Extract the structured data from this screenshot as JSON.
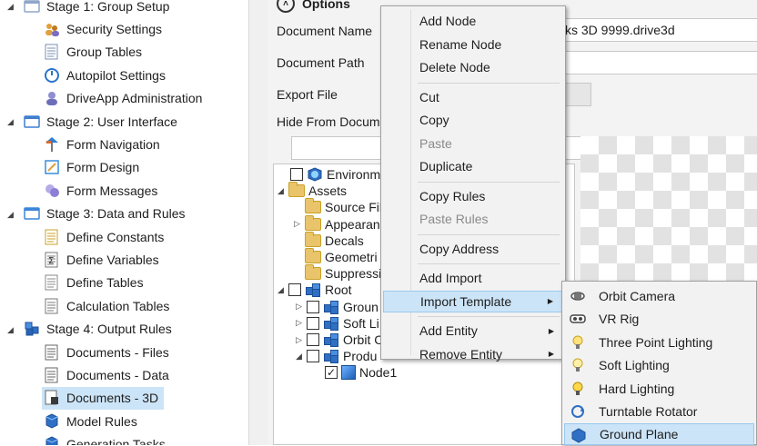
{
  "nav": {
    "items": [
      {
        "label": "Stage 1: Group Setup",
        "level": 0,
        "icon": "stage-setup-icon"
      },
      {
        "label": "Security Settings",
        "level": 1,
        "icon": "security-icon"
      },
      {
        "label": "Group Tables",
        "level": 1,
        "icon": "group-tables-icon"
      },
      {
        "label": "Autopilot Settings",
        "level": 1,
        "icon": "autopilot-icon"
      },
      {
        "label": "DriveApp Administration",
        "level": 1,
        "icon": "admin-icon"
      },
      {
        "label": "Stage 2: User Interface",
        "level": 0,
        "icon": "stage-ui-icon"
      },
      {
        "label": "Form Navigation",
        "level": 1,
        "icon": "form-navigation-icon"
      },
      {
        "label": "Form Design",
        "level": 1,
        "icon": "form-design-icon"
      },
      {
        "label": "Form Messages",
        "level": 1,
        "icon": "form-messages-icon"
      },
      {
        "label": "Stage 3: Data and Rules",
        "level": 0,
        "icon": "stage-data-icon"
      },
      {
        "label": "Define Constants",
        "level": 1,
        "icon": "constants-icon"
      },
      {
        "label": "Define Variables",
        "level": 1,
        "icon": "variables-icon"
      },
      {
        "label": "Define Tables",
        "level": 1,
        "icon": "tables-icon"
      },
      {
        "label": "Calculation Tables",
        "level": 1,
        "icon": "calc-tables-icon"
      },
      {
        "label": "Stage 4: Output Rules",
        "level": 0,
        "icon": "stage-output-icon"
      },
      {
        "label": "Documents - Files",
        "level": 1,
        "icon": "documents-files-icon"
      },
      {
        "label": "Documents - Data",
        "level": 1,
        "icon": "documents-data-icon"
      },
      {
        "label": "Documents - 3D",
        "level": 1,
        "icon": "documents-3d-icon",
        "selected": true
      },
      {
        "label": "Model Rules",
        "level": 1,
        "icon": "model-rules-icon"
      },
      {
        "label": "Generation Tasks",
        "level": 1,
        "icon": "generation-tasks-icon"
      }
    ]
  },
  "options": {
    "title": "Options",
    "document_name_label": "Document Name",
    "document_name_value": "ks 3D 9999.drive3d",
    "document_path_label": "Document Path",
    "export_file_label": "Export File",
    "hide_from_label": "Hide From Docum"
  },
  "tree": {
    "nodes": [
      {
        "label": "Environm",
        "depth": 1,
        "checkbox": true,
        "icon": "environment-icon"
      },
      {
        "label": "Assets",
        "depth": 0,
        "expander": "open",
        "icon": "folder-icon"
      },
      {
        "label": "Source Fil",
        "depth": 1,
        "icon": "folder-icon"
      },
      {
        "label": "Appearan",
        "depth": 1,
        "expander": "closed",
        "icon": "folder-icon"
      },
      {
        "label": "Decals",
        "depth": 1,
        "icon": "folder-icon"
      },
      {
        "label": "Geometri",
        "depth": 1,
        "icon": "folder-icon"
      },
      {
        "label": "Suppressi",
        "depth": 1,
        "icon": "folder-icon"
      },
      {
        "label": "Root",
        "depth": 0,
        "expander": "open",
        "checkbox": true,
        "icon": "cubes-icon"
      },
      {
        "label": "Groun",
        "depth": 1,
        "expander": "closed",
        "checkbox": true,
        "icon": "cubes-icon"
      },
      {
        "label": "Soft Li",
        "depth": 1,
        "expander": "closed",
        "checkbox": true,
        "icon": "cubes-icon"
      },
      {
        "label": "Orbit C",
        "depth": 1,
        "expander": "closed",
        "checkbox": true,
        "icon": "cubes-icon"
      },
      {
        "label": "Produ",
        "depth": 1,
        "expander": "open",
        "checkbox": true,
        "icon": "cubes-icon"
      },
      {
        "label": "Node1",
        "depth": 2,
        "checkbox": true,
        "checked": true,
        "icon": "cube-icon"
      }
    ]
  },
  "context_menu": {
    "items": [
      {
        "label": "Add Node"
      },
      {
        "label": "Rename Node"
      },
      {
        "label": "Delete Node"
      },
      {
        "separator": true
      },
      {
        "label": "Cut"
      },
      {
        "label": "Copy"
      },
      {
        "label": "Paste",
        "disabled": true
      },
      {
        "label": "Duplicate"
      },
      {
        "separator": true
      },
      {
        "label": "Copy Rules"
      },
      {
        "label": "Paste Rules",
        "disabled": true
      },
      {
        "separator": true
      },
      {
        "label": "Copy Address"
      },
      {
        "separator": true
      },
      {
        "label": "Add Import"
      },
      {
        "label": "Import Template",
        "submenu": true,
        "highlighted": true
      },
      {
        "separator": true
      },
      {
        "label": "Add Entity",
        "submenu": true
      },
      {
        "label": "Remove Entity",
        "submenu": true
      }
    ]
  },
  "template_submenu": {
    "items": [
      {
        "label": "Orbit Camera",
        "icon": "orbit-camera-icon"
      },
      {
        "label": "VR Rig",
        "icon": "vr-rig-icon"
      },
      {
        "label": "Three Point Lighting",
        "icon": "three-point-lighting-icon"
      },
      {
        "label": "Soft Lighting",
        "icon": "soft-lighting-icon"
      },
      {
        "label": "Hard Lighting",
        "icon": "hard-lighting-icon"
      },
      {
        "label": "Turntable Rotator",
        "icon": "turntable-rotator-icon"
      },
      {
        "label": "Ground Plane",
        "icon": "ground-plane-icon",
        "highlighted": true
      }
    ]
  },
  "colors": {
    "selection": "#cce4f7",
    "menu_background": "#f2f2f2",
    "cube_blue": "#2f6fc4"
  }
}
